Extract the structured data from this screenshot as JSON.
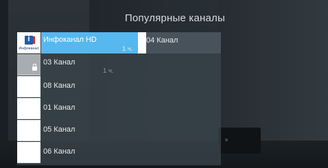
{
  "screen": {
    "title": "Популярные каналы"
  },
  "channels": [
    {
      "name": "Инфоканал HD",
      "logo_caption": "Инфоканал",
      "time": "1 ч.",
      "focused": true
    },
    {
      "name": "03 Канал",
      "time": "1 ч.",
      "locked": true
    },
    {
      "name": "08 Канал"
    },
    {
      "name": "01 Канал"
    },
    {
      "name": "05 Канал"
    },
    {
      "name": "06 Канал"
    }
  ],
  "next_column": [
    {
      "name": "04 Канал"
    }
  ],
  "colors": {
    "focus": "#56b8ee",
    "info_logo_blue": "#1f5fa8",
    "info_logo_red": "#d32b2b"
  },
  "icons": [
    "infokanal-logo-icon",
    "lock-icon"
  ]
}
